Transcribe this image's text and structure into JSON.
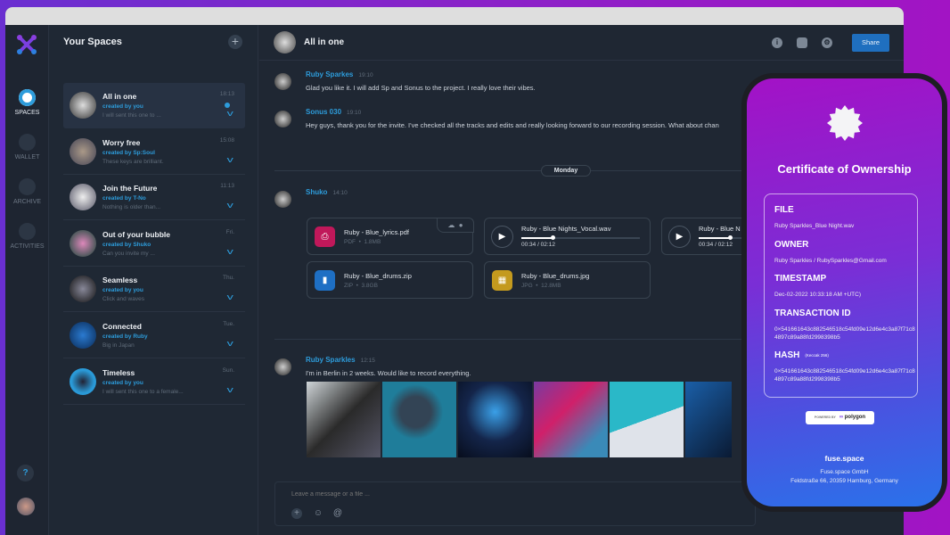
{
  "nav": {
    "items": [
      {
        "label": "SPACES",
        "icon": "spaces-icon",
        "active": true
      },
      {
        "label": "WALLET",
        "icon": "wallet-icon"
      },
      {
        "label": "ARCHIVE",
        "icon": "archive-icon"
      },
      {
        "label": "ACTIVITIES",
        "icon": "bell-icon"
      }
    ],
    "help": "?"
  },
  "spaces": {
    "title": "Your Spaces",
    "add": "+",
    "items": [
      {
        "title": "All in one",
        "creator": "created by you",
        "preview": "I will sent this one to ...",
        "time": "18:13",
        "unread": true
      },
      {
        "title": "Worry free",
        "creator": "created by Sp:Soul",
        "preview": "These keys are brilliant.",
        "time": "15:08"
      },
      {
        "title": "Join the Future",
        "creator": "created by T-No",
        "preview": "Nothing is older than...",
        "time": "11:13"
      },
      {
        "title": "Out of your bubble",
        "creator": "created by Shuko",
        "preview": "Can you invite my ...",
        "time": "Fri."
      },
      {
        "title": "Seamless",
        "creator": "created by you",
        "preview": "Click and waves",
        "time": "Thu."
      },
      {
        "title": "Connected",
        "creator": "created by Ruby",
        "preview": "Big in Japan",
        "time": "Tue."
      },
      {
        "title": "Timeless",
        "creator": "created by you",
        "preview": "I will sent this one to a female...",
        "time": "Sun."
      }
    ]
  },
  "chat": {
    "title": "All in one",
    "share": "Share",
    "day": "Monday",
    "messages": [
      {
        "name": "Ruby Sparkes",
        "time": "19:10",
        "text": "Glad you like it. I will add Sp and Sonus to the project. I really love their vibes."
      },
      {
        "name": "Sonus 030",
        "time": "19:10",
        "text": "Hey guys, thank you for the invite. I've checked all the tracks and edits and really looking forward to our recording session. What about chan"
      },
      {
        "name": "Shuko",
        "time": "14:10"
      },
      {
        "name": "Ruby Sparkles",
        "time": "12:15",
        "text": "I'm in Berlin in 2 weeks. Would like to record everything."
      }
    ],
    "files": [
      {
        "name": "Ruby - Blue_lyrics.pdf",
        "type": "PDF",
        "size": "1.8MB",
        "color": "#c0185a"
      },
      {
        "name": "Ruby - Blue Nights_Vocal.wav",
        "progress_time": "00:34 / 02:12",
        "progress": 0.26
      },
      {
        "name": "Ruby - Blue N",
        "progress_time": "00:34 / 02:12",
        "progress": 0.26
      },
      {
        "name": "Ruby - Blue_drums.zip",
        "type": "ZIP",
        "size": "3.8GB",
        "color": "#1e6fc4"
      },
      {
        "name": "Ruby - Blue_drums.jpg",
        "type": "JPG",
        "size": "12.8MB",
        "color": "#c49a1e"
      }
    ],
    "input_placeholder": "Leave a message or a file ..."
  },
  "certificate": {
    "title": "Certificate of Ownership",
    "file_label": "FILE",
    "file": "Ruby Sparkles_Blue Night.wav",
    "owner_label": "OWNER",
    "owner": "Ruby Sparkles / RubySparkles@Gmail.com",
    "timestamp_label": "TIMESTAMP",
    "timestamp": "Dec-02-2022 10:33:18 AM +UTC)",
    "tx_label": "TRANSACTION ID",
    "tx": "0×541661643c882546518c54fd09e12d6e4c3a87f71c84897c89a88fd2998398b5",
    "hash_label": "HASH",
    "hash_note": "(Keccak 256)",
    "hash": "0×541661643c882546518c54fd09e12d6e4c3a87f71c84897c89a88fd2998398b5",
    "powered_by": "POWERED BY",
    "polygon": "polygon",
    "site": "fuse.space",
    "company": "Fuse.space GmbH",
    "address": "Feldstraße 66, 20359 Hamburg, Germany"
  },
  "colors": {
    "accent": "#2d9cdb",
    "background": "#1f2733",
    "share": "#1f6fbf"
  }
}
